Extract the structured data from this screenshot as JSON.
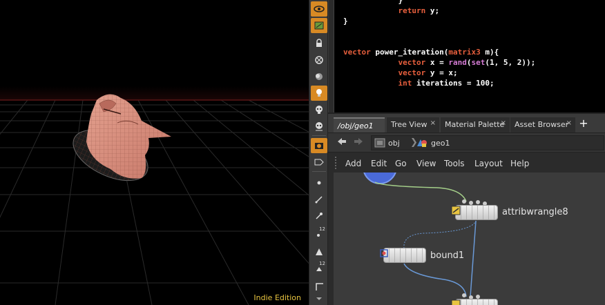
{
  "viewport": {
    "edition_label": "Indie Edition"
  },
  "shelf": {
    "tools": [
      {
        "icon": "view-icon"
      },
      {
        "icon": "display-options-icon"
      },
      {
        "icon": "lock-icon"
      },
      {
        "icon": "snapshot-icon"
      },
      {
        "icon": "ghost-icon"
      },
      {
        "icon": "light-icon"
      },
      {
        "icon": "skull-icon"
      },
      {
        "icon": "skull-lit-icon"
      },
      {
        "icon": "camera-icon"
      },
      {
        "icon": "display-flags-icon"
      },
      {
        "icon": "point-icon"
      },
      {
        "icon": "normal-icon"
      },
      {
        "icon": "pin-icon"
      },
      {
        "icon": "point-numbers-icon",
        "badge": "12"
      },
      {
        "icon": "shading-icon"
      },
      {
        "icon": "prim-numbers-icon",
        "badge": "12"
      },
      {
        "icon": "eraser-icon"
      },
      {
        "icon": "corner-icon"
      }
    ]
  },
  "code": {
    "lines": [
      {
        "indent": "            ",
        "parts": [
          {
            "t": "}",
            "c": "plain"
          }
        ]
      },
      {
        "indent": "            ",
        "parts": [
          {
            "t": "return",
            "c": "kw"
          },
          {
            "t": " y;",
            "c": "plain"
          }
        ]
      },
      {
        "indent": "",
        "parts": [
          {
            "t": "}",
            "c": "plain"
          }
        ]
      },
      {
        "indent": "",
        "parts": []
      },
      {
        "indent": "",
        "parts": []
      },
      {
        "indent": "",
        "parts": [
          {
            "t": "vector",
            "c": "kw"
          },
          {
            "t": " power_iteration(",
            "c": "plain"
          },
          {
            "t": "matrix3",
            "c": "kw"
          },
          {
            "t": " m){",
            "c": "plain"
          }
        ]
      },
      {
        "indent": "            ",
        "parts": [
          {
            "t": "vector",
            "c": "kw"
          },
          {
            "t": " x = ",
            "c": "plain"
          },
          {
            "t": "rand",
            "c": "fn"
          },
          {
            "t": "(",
            "c": "plain"
          },
          {
            "t": "set",
            "c": "fn"
          },
          {
            "t": "(1, 5, 2));",
            "c": "plain"
          }
        ]
      },
      {
        "indent": "            ",
        "parts": [
          {
            "t": "vector",
            "c": "kw"
          },
          {
            "t": " y = x;",
            "c": "plain"
          }
        ]
      },
      {
        "indent": "            ",
        "parts": [
          {
            "t": "int",
            "c": "kw"
          },
          {
            "t": " iterations = 100;",
            "c": "plain"
          }
        ]
      }
    ]
  },
  "tabs": [
    {
      "label": "/obj/geo1",
      "active": true
    },
    {
      "label": "Tree View",
      "active": false
    },
    {
      "label": "Material Palette",
      "active": false
    },
    {
      "label": "Asset Browser",
      "active": false
    }
  ],
  "tab_close_glyph": "×",
  "tab_add_glyph": "+",
  "path": {
    "root": "obj",
    "current": "geo1"
  },
  "menus": [
    "Add",
    "Edit",
    "Go",
    "View",
    "Tools",
    "Layout",
    "Help"
  ],
  "nodes": {
    "attribwrangle8": {
      "label": "attribwrangle8"
    },
    "bound1": {
      "label": "bound1"
    }
  },
  "colors": {
    "accent": "#d88a24",
    "edition": "#e8c440",
    "keyword": "#e85f3d",
    "function": "#d47bd4"
  }
}
